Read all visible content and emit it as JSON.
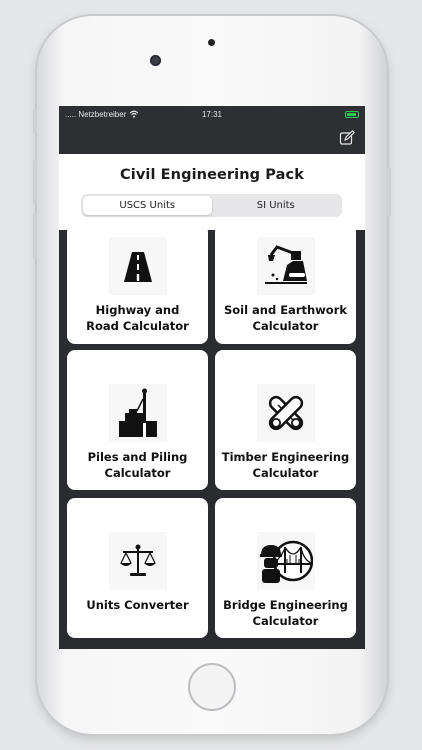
{
  "status_bar": {
    "carrier": "..... Netzbetreiber",
    "time": "17:31"
  },
  "header": {
    "title": "Civil Engineering Pack"
  },
  "units_segment": {
    "options": [
      "USCS Units",
      "SI Units"
    ],
    "selected": "USCS Units"
  },
  "calculators": [
    {
      "label": "Highway and\nRoad Calculator",
      "icon": "road-icon"
    },
    {
      "label": "Soil and Earthwork\nCalculator",
      "icon": "excavator-icon"
    },
    {
      "label": "Piles and Piling\nCalculator",
      "icon": "pile-driver-icon"
    },
    {
      "label": "Timber Engineering\nCalculator",
      "icon": "crossed-logs-icon"
    },
    {
      "label": "Units Converter",
      "icon": "balance-scale-icon"
    },
    {
      "label": "Bridge Engineering\nCalculator",
      "icon": "bridge-engineer-icon"
    }
  ],
  "colors": {
    "navbar": "#2e2f33",
    "grid_background": "#2b2c30",
    "card": "#ffffff",
    "battery": "#2ec954"
  }
}
